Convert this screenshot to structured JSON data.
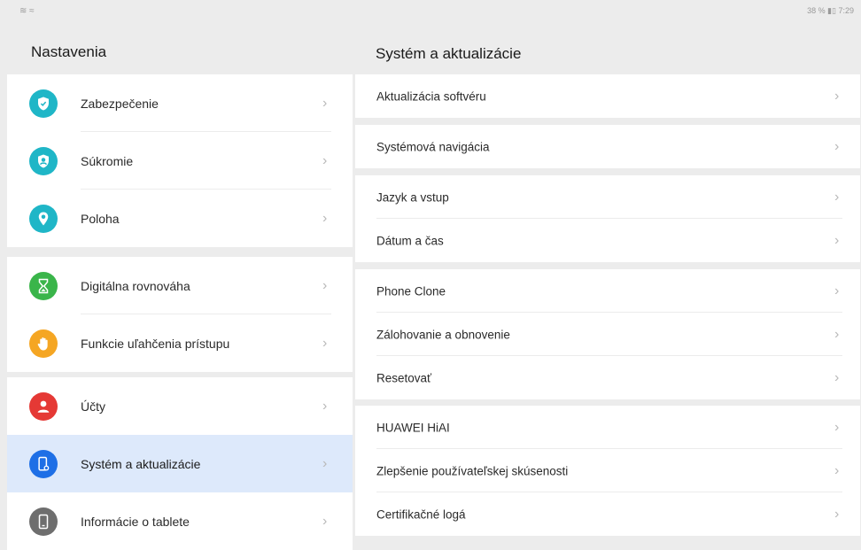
{
  "status_bar": {
    "left": "≋ ≈",
    "right": "38 % ▮▯ 7:29"
  },
  "left_panel": {
    "title": "Nastavenia",
    "groups": [
      [
        {
          "label": "Zabezpečenie",
          "icon": "shield-icon",
          "color": "#1fb6c7"
        },
        {
          "label": "Súkromie",
          "icon": "privacy-icon",
          "color": "#1fb6c7"
        },
        {
          "label": "Poloha",
          "icon": "location-pin-icon",
          "color": "#1fb6c7"
        }
      ],
      [
        {
          "label": "Digitálna rovnováha",
          "icon": "hourglass-icon",
          "color": "#3ab54a"
        },
        {
          "label": "Funkcie uľahčenia prístupu",
          "icon": "hand-icon",
          "color": "#f5a623"
        }
      ],
      [
        {
          "label": "Účty",
          "icon": "account-icon",
          "color": "#e53935"
        },
        {
          "label": "Systém a aktualizácie",
          "icon": "system-icon",
          "color": "#1e6fe6",
          "selected": true
        },
        {
          "label": "Informácie o tablete",
          "icon": "tablet-icon",
          "color": "#6e6e6e"
        }
      ]
    ]
  },
  "right_panel": {
    "title": "Systém a aktualizácie",
    "groups": [
      [
        "Aktualizácia softvéru"
      ],
      [
        "Systémová navigácia"
      ],
      [
        "Jazyk a vstup",
        "Dátum a čas"
      ],
      [
        "Phone Clone",
        "Zálohovanie a obnovenie",
        "Resetovať"
      ],
      [
        "HUAWEI HiAI",
        "Zlepšenie používateľskej skúsenosti",
        "Certifikačné logá"
      ]
    ]
  },
  "chevron": "›"
}
